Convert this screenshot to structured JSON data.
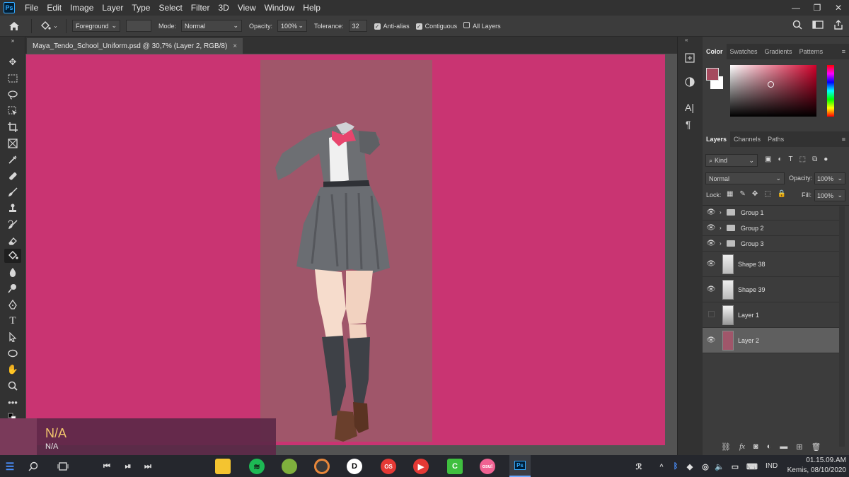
{
  "app": {
    "logo": "Ps",
    "menu": [
      "File",
      "Edit",
      "Image",
      "Layer",
      "Type",
      "Select",
      "Filter",
      "3D",
      "View",
      "Window",
      "Help"
    ]
  },
  "options": {
    "fill_source": "Foreground",
    "mode_label": "Mode:",
    "mode_value": "Normal",
    "opacity_label": "Opacity:",
    "opacity_value": "100%",
    "tolerance_label": "Tolerance:",
    "tolerance_value": "32",
    "anti_alias": "Anti-alias",
    "contiguous": "Contiguous",
    "all_layers": "All Layers"
  },
  "document": {
    "tab_title": "Maya_Tendo_School_Uniform.psd @ 30,7% (Layer 2, RGB/8)",
    "close": "×"
  },
  "color_panel": {
    "tabs": [
      "Color",
      "Swatches",
      "Gradients",
      "Patterns"
    ],
    "foreground": "#a54a5e",
    "background": "#ffffff"
  },
  "layers_panel": {
    "tabs": [
      "Layers",
      "Channels",
      "Paths"
    ],
    "filter": "Kind",
    "blend_mode": "Normal",
    "opacity_label": "Opacity:",
    "opacity_value": "100%",
    "lock_label": "Lock:",
    "fill_label": "Fill:",
    "fill_value": "100%",
    "layers": [
      {
        "name": "Group 1",
        "type": "group",
        "visible": true
      },
      {
        "name": "Group 2",
        "type": "group",
        "visible": true
      },
      {
        "name": "Group 3",
        "type": "group",
        "visible": true
      },
      {
        "name": "Shape 38",
        "type": "shape",
        "visible": true
      },
      {
        "name": "Shape 39",
        "type": "shape",
        "visible": true
      },
      {
        "name": "Layer 1",
        "type": "pixel",
        "visible": false
      },
      {
        "name": "Layer 2",
        "type": "pixel",
        "visible": true,
        "selected": true
      }
    ]
  },
  "media": {
    "title": "N/A",
    "subtitle": "N/A"
  },
  "taskbar": {
    "language": "IND",
    "time": "01.15.09.AM",
    "date": "Kemis, 08/10/2020"
  },
  "colors": {
    "canvas_bg": "#c93472",
    "layer_rect": "#a0566a",
    "accent": "#31a8ff"
  }
}
